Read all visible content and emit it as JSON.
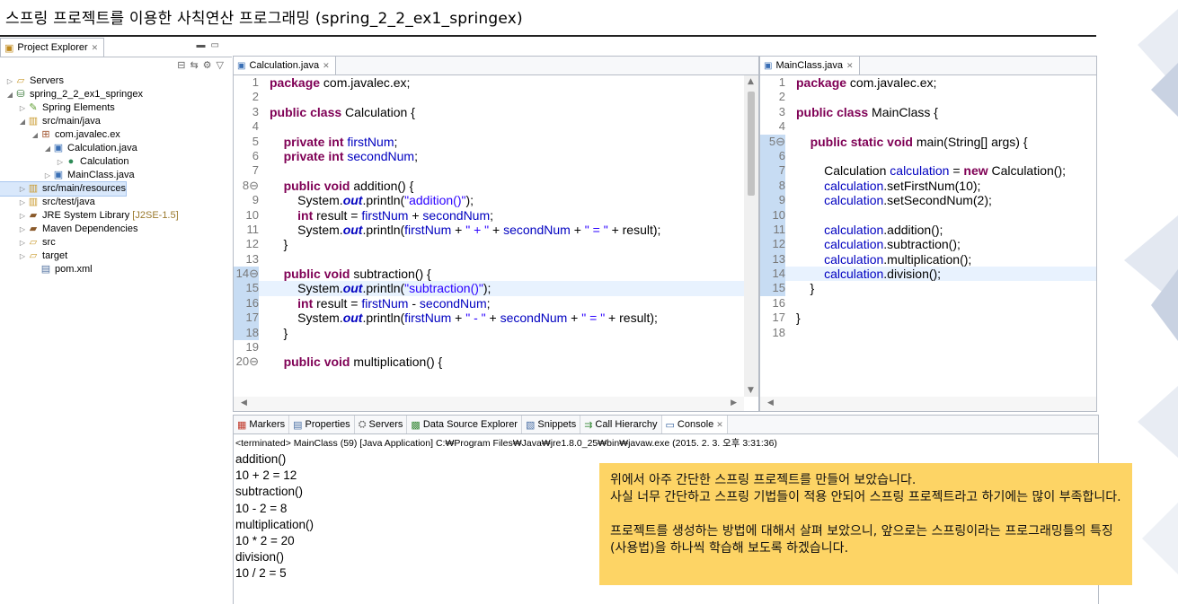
{
  "slide_title": "스프링 프로젝트를 이용한 사칙연산 프로그래밍 (spring_2_2_ex1_springex)",
  "project_explorer": {
    "tab_label": "Project Explorer",
    "tree": [
      {
        "label": "Servers",
        "icon": "folder-icon",
        "twisty": "▷"
      },
      {
        "label": "spring_2_2_ex1_springex",
        "icon": "spring-project-icon",
        "twisty": "◢"
      },
      {
        "label": "Spring Elements",
        "icon": "spring-elements-icon",
        "twisty": "▷"
      },
      {
        "label": "src/main/java",
        "icon": "source-folder-icon",
        "twisty": "◢"
      },
      {
        "label": "com.javalec.ex",
        "icon": "package-icon",
        "twisty": "◢"
      },
      {
        "label": "Calculation.java",
        "icon": "java-file-icon",
        "twisty": "◢"
      },
      {
        "label": "Calculation",
        "icon": "class-icon",
        "twisty": "▷"
      },
      {
        "label": "MainClass.java",
        "icon": "java-file-icon",
        "twisty": "▷"
      },
      {
        "label": "src/main/resources",
        "icon": "source-folder-icon",
        "twisty": "▷"
      },
      {
        "label": "src/test/java",
        "icon": "source-folder-icon",
        "twisty": "▷"
      },
      {
        "label": "JRE System Library",
        "decoration": "[J2SE-1.5]",
        "icon": "library-icon",
        "twisty": "▷"
      },
      {
        "label": "Maven Dependencies",
        "icon": "library-icon",
        "twisty": "▷"
      },
      {
        "label": "src",
        "icon": "folder-icon",
        "twisty": "▷"
      },
      {
        "label": "target",
        "icon": "folder-icon",
        "twisty": "▷"
      },
      {
        "label": "pom.xml",
        "icon": "xml-file-icon",
        "twisty": ""
      }
    ]
  },
  "editor_calculation": {
    "tab_label": "Calculation.java",
    "lines": [
      {
        "n": "1",
        "code": [
          {
            "t": "package",
            "c": "kw"
          },
          {
            "t": " com.javalec.ex;"
          }
        ]
      },
      {
        "n": "2",
        "code": []
      },
      {
        "n": "3",
        "code": [
          {
            "t": "public",
            "c": "kw"
          },
          {
            "t": " "
          },
          {
            "t": "class",
            "c": "kw"
          },
          {
            "t": " Calculation {"
          }
        ]
      },
      {
        "n": "4",
        "code": []
      },
      {
        "n": "5",
        "code": [
          {
            "t": "    "
          },
          {
            "t": "private",
            "c": "kw"
          },
          {
            "t": " "
          },
          {
            "t": "int",
            "c": "kw"
          },
          {
            "t": " "
          },
          {
            "t": "firstNum",
            "c": "fld"
          },
          {
            "t": ";"
          }
        ]
      },
      {
        "n": "6",
        "code": [
          {
            "t": "    "
          },
          {
            "t": "private",
            "c": "kw"
          },
          {
            "t": " "
          },
          {
            "t": "int",
            "c": "kw"
          },
          {
            "t": " "
          },
          {
            "t": "secondNum",
            "c": "fld"
          },
          {
            "t": ";"
          }
        ]
      },
      {
        "n": "7",
        "code": []
      },
      {
        "n": "8⊖",
        "code": [
          {
            "t": "    "
          },
          {
            "t": "public",
            "c": "kw"
          },
          {
            "t": " "
          },
          {
            "t": "void",
            "c": "kw"
          },
          {
            "t": " addition() {"
          }
        ]
      },
      {
        "n": "9",
        "code": [
          {
            "t": "        System."
          },
          {
            "t": "out",
            "c": "st"
          },
          {
            "t": ".println("
          },
          {
            "t": "\"addition()\"",
            "c": "str"
          },
          {
            "t": ");"
          }
        ]
      },
      {
        "n": "10",
        "code": [
          {
            "t": "        "
          },
          {
            "t": "int",
            "c": "kw"
          },
          {
            "t": " result = "
          },
          {
            "t": "firstNum",
            "c": "fld"
          },
          {
            "t": " + "
          },
          {
            "t": "secondNum",
            "c": "fld"
          },
          {
            "t": ";"
          }
        ]
      },
      {
        "n": "11",
        "code": [
          {
            "t": "        System."
          },
          {
            "t": "out",
            "c": "st"
          },
          {
            "t": ".println("
          },
          {
            "t": "firstNum",
            "c": "fld"
          },
          {
            "t": " + "
          },
          {
            "t": "\" + \"",
            "c": "str"
          },
          {
            "t": " + "
          },
          {
            "t": "secondNum",
            "c": "fld"
          },
          {
            "t": " + "
          },
          {
            "t": "\" = \"",
            "c": "str"
          },
          {
            "t": " + result);"
          }
        ]
      },
      {
        "n": "12",
        "code": [
          {
            "t": "    }"
          }
        ]
      },
      {
        "n": "13",
        "code": []
      },
      {
        "n": "14⊖",
        "marked": true,
        "code": [
          {
            "t": "    "
          },
          {
            "t": "public",
            "c": "kw"
          },
          {
            "t": " "
          },
          {
            "t": "void",
            "c": "kw"
          },
          {
            "t": " subtraction() {"
          }
        ]
      },
      {
        "n": "15",
        "marked": true,
        "hl": true,
        "code": [
          {
            "t": "        System."
          },
          {
            "t": "out",
            "c": "st"
          },
          {
            "t": ".println("
          },
          {
            "t": "\"subtraction()\"",
            "c": "str"
          },
          {
            "t": ");"
          }
        ]
      },
      {
        "n": "16",
        "marked": true,
        "code": [
          {
            "t": "        "
          },
          {
            "t": "int",
            "c": "kw"
          },
          {
            "t": " result = "
          },
          {
            "t": "firstNum",
            "c": "fld"
          },
          {
            "t": " - "
          },
          {
            "t": "secondNum",
            "c": "fld"
          },
          {
            "t": ";"
          }
        ]
      },
      {
        "n": "17",
        "marked": true,
        "code": [
          {
            "t": "        System."
          },
          {
            "t": "out",
            "c": "st"
          },
          {
            "t": ".println("
          },
          {
            "t": "firstNum",
            "c": "fld"
          },
          {
            "t": " + "
          },
          {
            "t": "\" - \"",
            "c": "str"
          },
          {
            "t": " + "
          },
          {
            "t": "secondNum",
            "c": "fld"
          },
          {
            "t": " + "
          },
          {
            "t": "\" = \"",
            "c": "str"
          },
          {
            "t": " + result);"
          }
        ]
      },
      {
        "n": "18",
        "marked": true,
        "code": [
          {
            "t": "    }"
          }
        ]
      },
      {
        "n": "19",
        "code": []
      },
      {
        "n": "20⊖",
        "code": [
          {
            "t": "    "
          },
          {
            "t": "public",
            "c": "kw"
          },
          {
            "t": " "
          },
          {
            "t": "void",
            "c": "kw"
          },
          {
            "t": " multiplication() {"
          }
        ]
      }
    ]
  },
  "editor_main": {
    "tab_label": "MainClass.java",
    "lines": [
      {
        "n": "1",
        "code": [
          {
            "t": "package",
            "c": "kw"
          },
          {
            "t": " com.javalec.ex;"
          }
        ]
      },
      {
        "n": "2",
        "code": []
      },
      {
        "n": "3",
        "code": [
          {
            "t": "public",
            "c": "kw"
          },
          {
            "t": " "
          },
          {
            "t": "class",
            "c": "kw"
          },
          {
            "t": " MainClass {"
          }
        ]
      },
      {
        "n": "4",
        "code": []
      },
      {
        "n": "5⊖",
        "marked": true,
        "code": [
          {
            "t": "    "
          },
          {
            "t": "public",
            "c": "kw"
          },
          {
            "t": " "
          },
          {
            "t": "static",
            "c": "kw"
          },
          {
            "t": " "
          },
          {
            "t": "void",
            "c": "kw"
          },
          {
            "t": " main(String[] args) {"
          }
        ]
      },
      {
        "n": "6",
        "marked": true,
        "code": []
      },
      {
        "n": "7",
        "marked": true,
        "code": [
          {
            "t": "        Calculation "
          },
          {
            "t": "calculation",
            "c": "fld"
          },
          {
            "t": " = "
          },
          {
            "t": "new",
            "c": "kw"
          },
          {
            "t": " Calculation();"
          }
        ]
      },
      {
        "n": "8",
        "marked": true,
        "code": [
          {
            "t": "        "
          },
          {
            "t": "calculation",
            "c": "fld"
          },
          {
            "t": ".setFirstNum(10);"
          }
        ]
      },
      {
        "n": "9",
        "marked": true,
        "code": [
          {
            "t": "        "
          },
          {
            "t": "calculation",
            "c": "fld"
          },
          {
            "t": ".setSecondNum(2);"
          }
        ]
      },
      {
        "n": "10",
        "marked": true,
        "code": []
      },
      {
        "n": "11",
        "marked": true,
        "code": [
          {
            "t": "        "
          },
          {
            "t": "calculation",
            "c": "fld"
          },
          {
            "t": ".addition();"
          }
        ]
      },
      {
        "n": "12",
        "marked": true,
        "code": [
          {
            "t": "        "
          },
          {
            "t": "calculation",
            "c": "fld"
          },
          {
            "t": ".subtraction();"
          }
        ]
      },
      {
        "n": "13",
        "marked": true,
        "code": [
          {
            "t": "        "
          },
          {
            "t": "calculation",
            "c": "fld"
          },
          {
            "t": ".multiplication();"
          }
        ]
      },
      {
        "n": "14",
        "marked": true,
        "hl": true,
        "code": [
          {
            "t": "        "
          },
          {
            "t": "calculation",
            "c": "fld"
          },
          {
            "t": ".division();"
          }
        ]
      },
      {
        "n": "15",
        "marked": true,
        "code": [
          {
            "t": "    }"
          }
        ]
      },
      {
        "n": "16",
        "code": []
      },
      {
        "n": "17",
        "code": [
          {
            "t": "}"
          }
        ]
      },
      {
        "n": "18",
        "code": []
      }
    ]
  },
  "console": {
    "tabs": [
      {
        "label": "Markers",
        "icon": "markers-icon"
      },
      {
        "label": "Properties",
        "icon": "properties-icon"
      },
      {
        "label": "Servers",
        "icon": "servers-icon"
      },
      {
        "label": "Data Source Explorer",
        "icon": "data-source-icon"
      },
      {
        "label": "Snippets",
        "icon": "snippets-icon"
      },
      {
        "label": "Call Hierarchy",
        "icon": "call-hierarchy-icon"
      },
      {
        "label": "Console",
        "icon": "console-icon",
        "active": true
      }
    ],
    "status": "<terminated> MainClass (59) [Java Application] C:₩Program Files₩Java₩jre1.8.0_25₩bin₩javaw.exe (2015. 2. 3. 오후 3:31:36)",
    "output": [
      "addition()",
      "10 + 2 = 12",
      "subtraction()",
      "10 - 2 = 8",
      "multiplication()",
      "10 * 2 = 20",
      "division()",
      "10 / 2 = 5"
    ]
  },
  "note": {
    "paragraph1": "위에서 아주 간단한 스프링 프로젝트를 만들어 보았습니다.",
    "paragraph2": "사실 너무 간단하고 스프링 기법들이 적용 안되어 스프링 프로젝트라고 하기에는 많이 부족합니다.",
    "paragraph3": "프로젝트를 생성하는 방법에 대해서 살펴 보았으니, 앞으로는 스프링이라는 프로그래밍틀의 특징(사용법)을 하나씩 학습해 보도록 하겠습니다.",
    "color": "#fdd465"
  }
}
